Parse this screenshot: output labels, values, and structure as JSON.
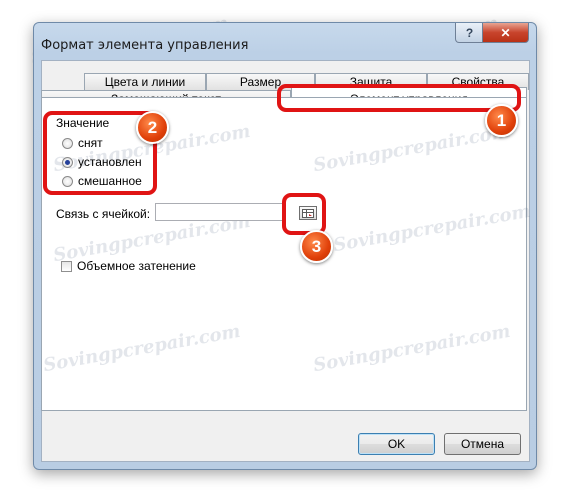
{
  "dialog": {
    "title": "Формат элемента управления",
    "help_glyph": "?",
    "close_glyph": "✕"
  },
  "tabs_back": [
    "Цвета и линии",
    "Размер",
    "Защита",
    "Свойства"
  ],
  "tabs_front": [
    "Замещающий текст",
    "Элемент управления"
  ],
  "value_group": {
    "label": "Значение",
    "options": [
      {
        "label": "снят",
        "selected": false
      },
      {
        "label": "установлен",
        "selected": true
      },
      {
        "label": "смешанное",
        "selected": false
      }
    ]
  },
  "cell_link": {
    "label": "Связь с ячейкой:",
    "value": ""
  },
  "shading": {
    "label": "Объемное затенение",
    "checked": false
  },
  "buttons": {
    "ok": "OK",
    "cancel": "Отмена"
  },
  "annotations": [
    "1",
    "2",
    "3"
  ],
  "watermark": "Sovingpcrepair.com",
  "colors": {
    "highlight": "#e01414",
    "badge": "#e0400a",
    "title_bar": "#bcd0e6"
  }
}
